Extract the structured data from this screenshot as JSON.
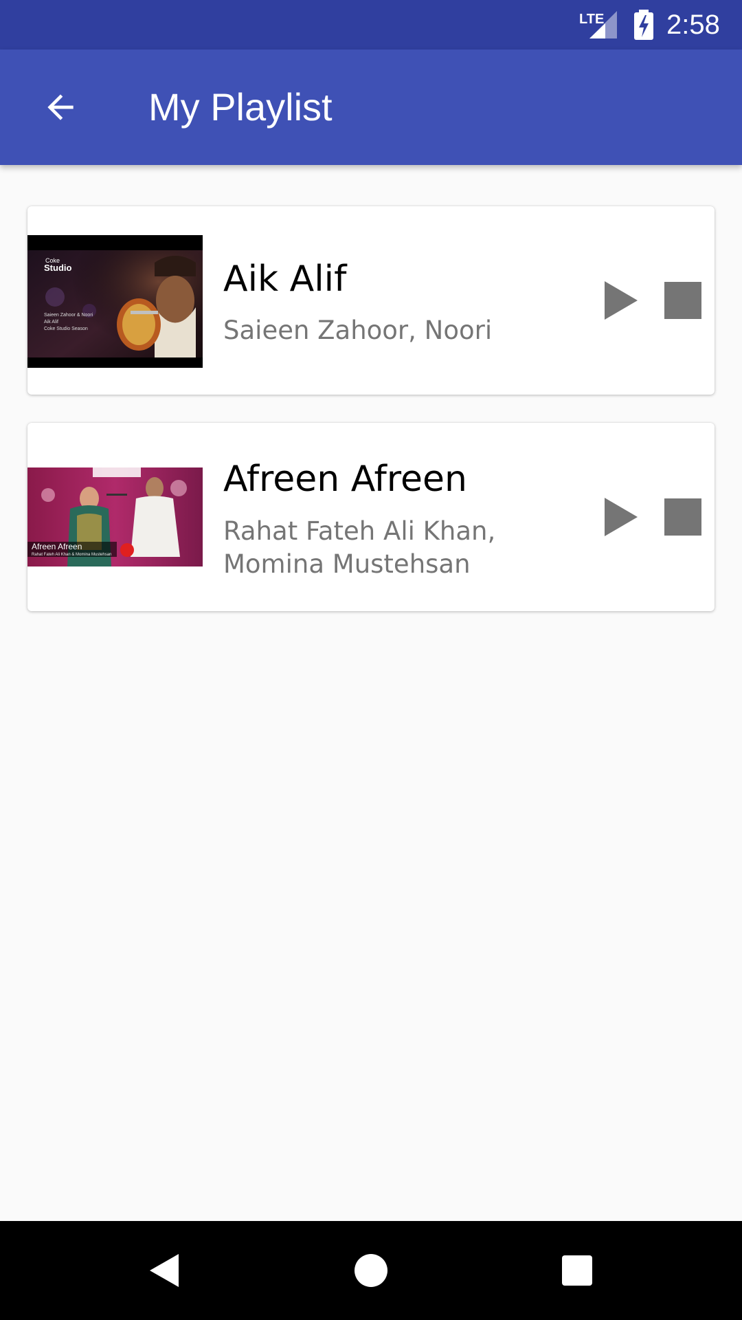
{
  "status_bar": {
    "network_label": "LTE",
    "time": "2:58",
    "icons": [
      "lte-signal-icon",
      "battery-charging-icon"
    ]
  },
  "app_bar": {
    "title": "My Playlist",
    "back_icon": "arrow-back-icon",
    "color": "#3f51b5",
    "status_color": "#303f9f"
  },
  "playlist": [
    {
      "title": "Aik Alif",
      "artist": "Saieen Zahoor, Noori",
      "thumbnail_text": {
        "brand_top": "Coke",
        "brand_bottom": "Studio",
        "caption_line1": "Saieen Zahoor & Noori",
        "caption_line2": "Aik Alif",
        "caption_line3": "Coke Studio Season"
      },
      "play_icon": "play-icon",
      "stop_icon": "stop-icon"
    },
    {
      "title": "Afreen Afreen",
      "artist": "Rahat Fateh Ali Khan, Momina Mustehsan",
      "thumbnail_text": {
        "caption_line1": "Afreen Afreen",
        "caption_line2": "Rahat Fateh Ali Khan & Momina Mustehsan"
      },
      "play_icon": "play-icon",
      "stop_icon": "stop-icon"
    }
  ],
  "nav_bar": {
    "icons": [
      "nav-back-icon",
      "nav-home-icon",
      "nav-recents-icon"
    ]
  },
  "colors": {
    "icon_gray": "#757575",
    "artist_text": "#757575",
    "background": "#fafafa"
  }
}
